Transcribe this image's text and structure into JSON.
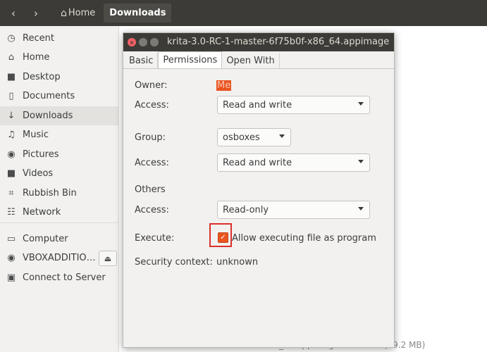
{
  "header": {
    "back_icon": "chevron-left-icon",
    "forward_icon": "chevron-right-icon",
    "home_crumb": "Home",
    "current_crumb": "Downloads"
  },
  "sidebar": {
    "items": [
      {
        "label": "Recent",
        "icon": "clock-icon"
      },
      {
        "label": "Home",
        "icon": "home-icon"
      },
      {
        "label": "Desktop",
        "icon": "folder-icon"
      },
      {
        "label": "Documents",
        "icon": "document-icon"
      },
      {
        "label": "Downloads",
        "icon": "download-icon",
        "selected": true
      },
      {
        "label": "Music",
        "icon": "music-icon"
      },
      {
        "label": "Pictures",
        "icon": "camera-icon"
      },
      {
        "label": "Videos",
        "icon": "video-icon"
      },
      {
        "label": "Rubbish Bin",
        "icon": "trash-icon"
      },
      {
        "label": "Network",
        "icon": "network-icon"
      },
      {
        "label": "Computer",
        "icon": "drive-icon"
      },
      {
        "label": "VBOXADDITIO…",
        "icon": "disc-icon"
      },
      {
        "label": "Connect to Server",
        "icon": "server-icon"
      }
    ]
  },
  "statusbar": {
    "text": "krita-3.0-RC-1-master-6f75b0f-x86_64.appimage\" selected  (79.2 MB)"
  },
  "dialog": {
    "title": "krita-3.0-RC-1-master-6f75b0f-x86_64.appimage",
    "tabs": [
      "Basic",
      "Permissions",
      "Open With"
    ],
    "active_tab": "Permissions",
    "owner_label": "Owner:",
    "owner_value": "Me",
    "owner_access_label": "Access:",
    "owner_access_value": "Read and write",
    "group_label": "Group:",
    "group_value": "osboxes",
    "group_access_label": "Access:",
    "group_access_value": "Read and write",
    "others_label": "Others",
    "others_access_label": "Access:",
    "others_access_value": "Read-only",
    "execute_label": "Execute:",
    "execute_checkbox_label": "Allow executing file as program",
    "execute_checked": true,
    "security_label": "Security context:",
    "security_value": "unknown"
  },
  "colors": {
    "accent": "#e95420",
    "titlebar": "#3c3b37",
    "highlight_box": "#d9302c"
  }
}
